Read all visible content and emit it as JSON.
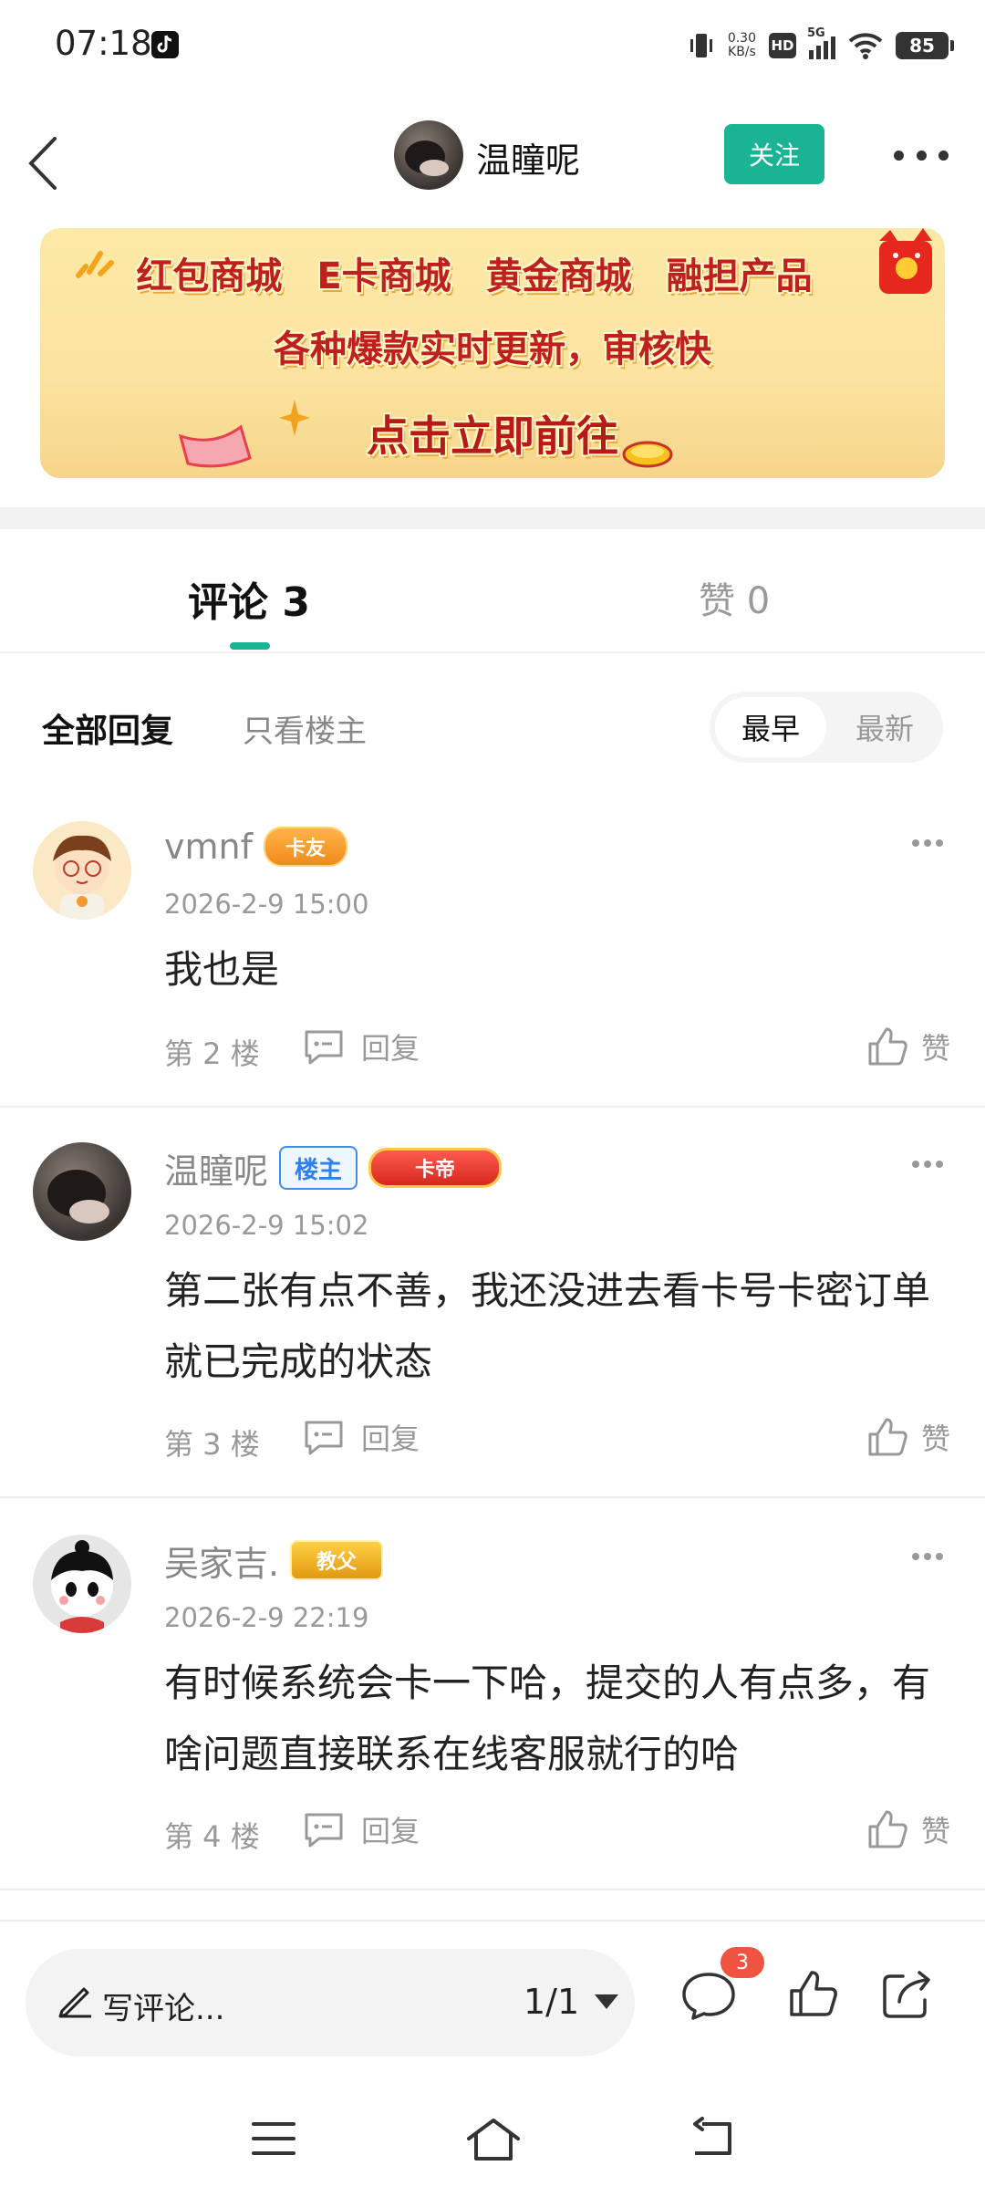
{
  "status_bar": {
    "time": "07:18",
    "net_speed_value": "0.30",
    "net_speed_unit": "KB/s",
    "hd": "HD",
    "network": "5G",
    "battery": "85"
  },
  "header": {
    "author_name": "温瞳呢",
    "follow_label": "关注"
  },
  "banner": {
    "items": [
      "红包商城",
      "E卡商城",
      "黄金商城",
      "融担产品"
    ],
    "subtitle": "各种爆款实时更新，审核快",
    "cta": "点击立即前往"
  },
  "tabs": {
    "comments": "评论 3",
    "likes": "赞 0"
  },
  "filter": {
    "all": "全部回复",
    "op_only": "只看楼主",
    "sort_earliest": "最早",
    "sort_latest": "最新"
  },
  "comments": [
    {
      "name": "vmnf",
      "badges": [
        "卡友"
      ],
      "time": "2026-2-9 15:00",
      "text": "我也是",
      "floor": "第 2 楼",
      "reply": "回复",
      "like": "赞"
    },
    {
      "name": "温瞳呢",
      "badges": [
        "楼主",
        "卡帝"
      ],
      "time": "2026-2-9 15:02",
      "text": "第二张有点不善，我还没进去看卡号卡密订单就已完成的状态",
      "floor": "第 3 楼",
      "reply": "回复",
      "like": "赞"
    },
    {
      "name": "吴家吉.",
      "badges": [
        "教父"
      ],
      "time": "2026-2-9 22:19",
      "text": "有时候系统会卡一下哈，提交的人有点多，有啥问题直接联系在线客服就行的哈",
      "floor": "第 4 楼",
      "reply": "回复",
      "like": "赞"
    }
  ],
  "bottom_bar": {
    "write_placeholder": "写评论...",
    "page_indicator": "1/1",
    "comment_count_badge": "3"
  },
  "colors": {
    "accent": "#1ab394",
    "badge_red": "#f0533f",
    "op_blue": "#2f80ed"
  },
  "icons": [
    "tiktok-icon",
    "vibrate-icon",
    "wifi-icon",
    "back-icon",
    "more-icon",
    "reply-icon",
    "like-icon",
    "pencil-icon",
    "comment-icon",
    "share-icon",
    "menu-icon",
    "home-icon",
    "back-nav-icon"
  ]
}
